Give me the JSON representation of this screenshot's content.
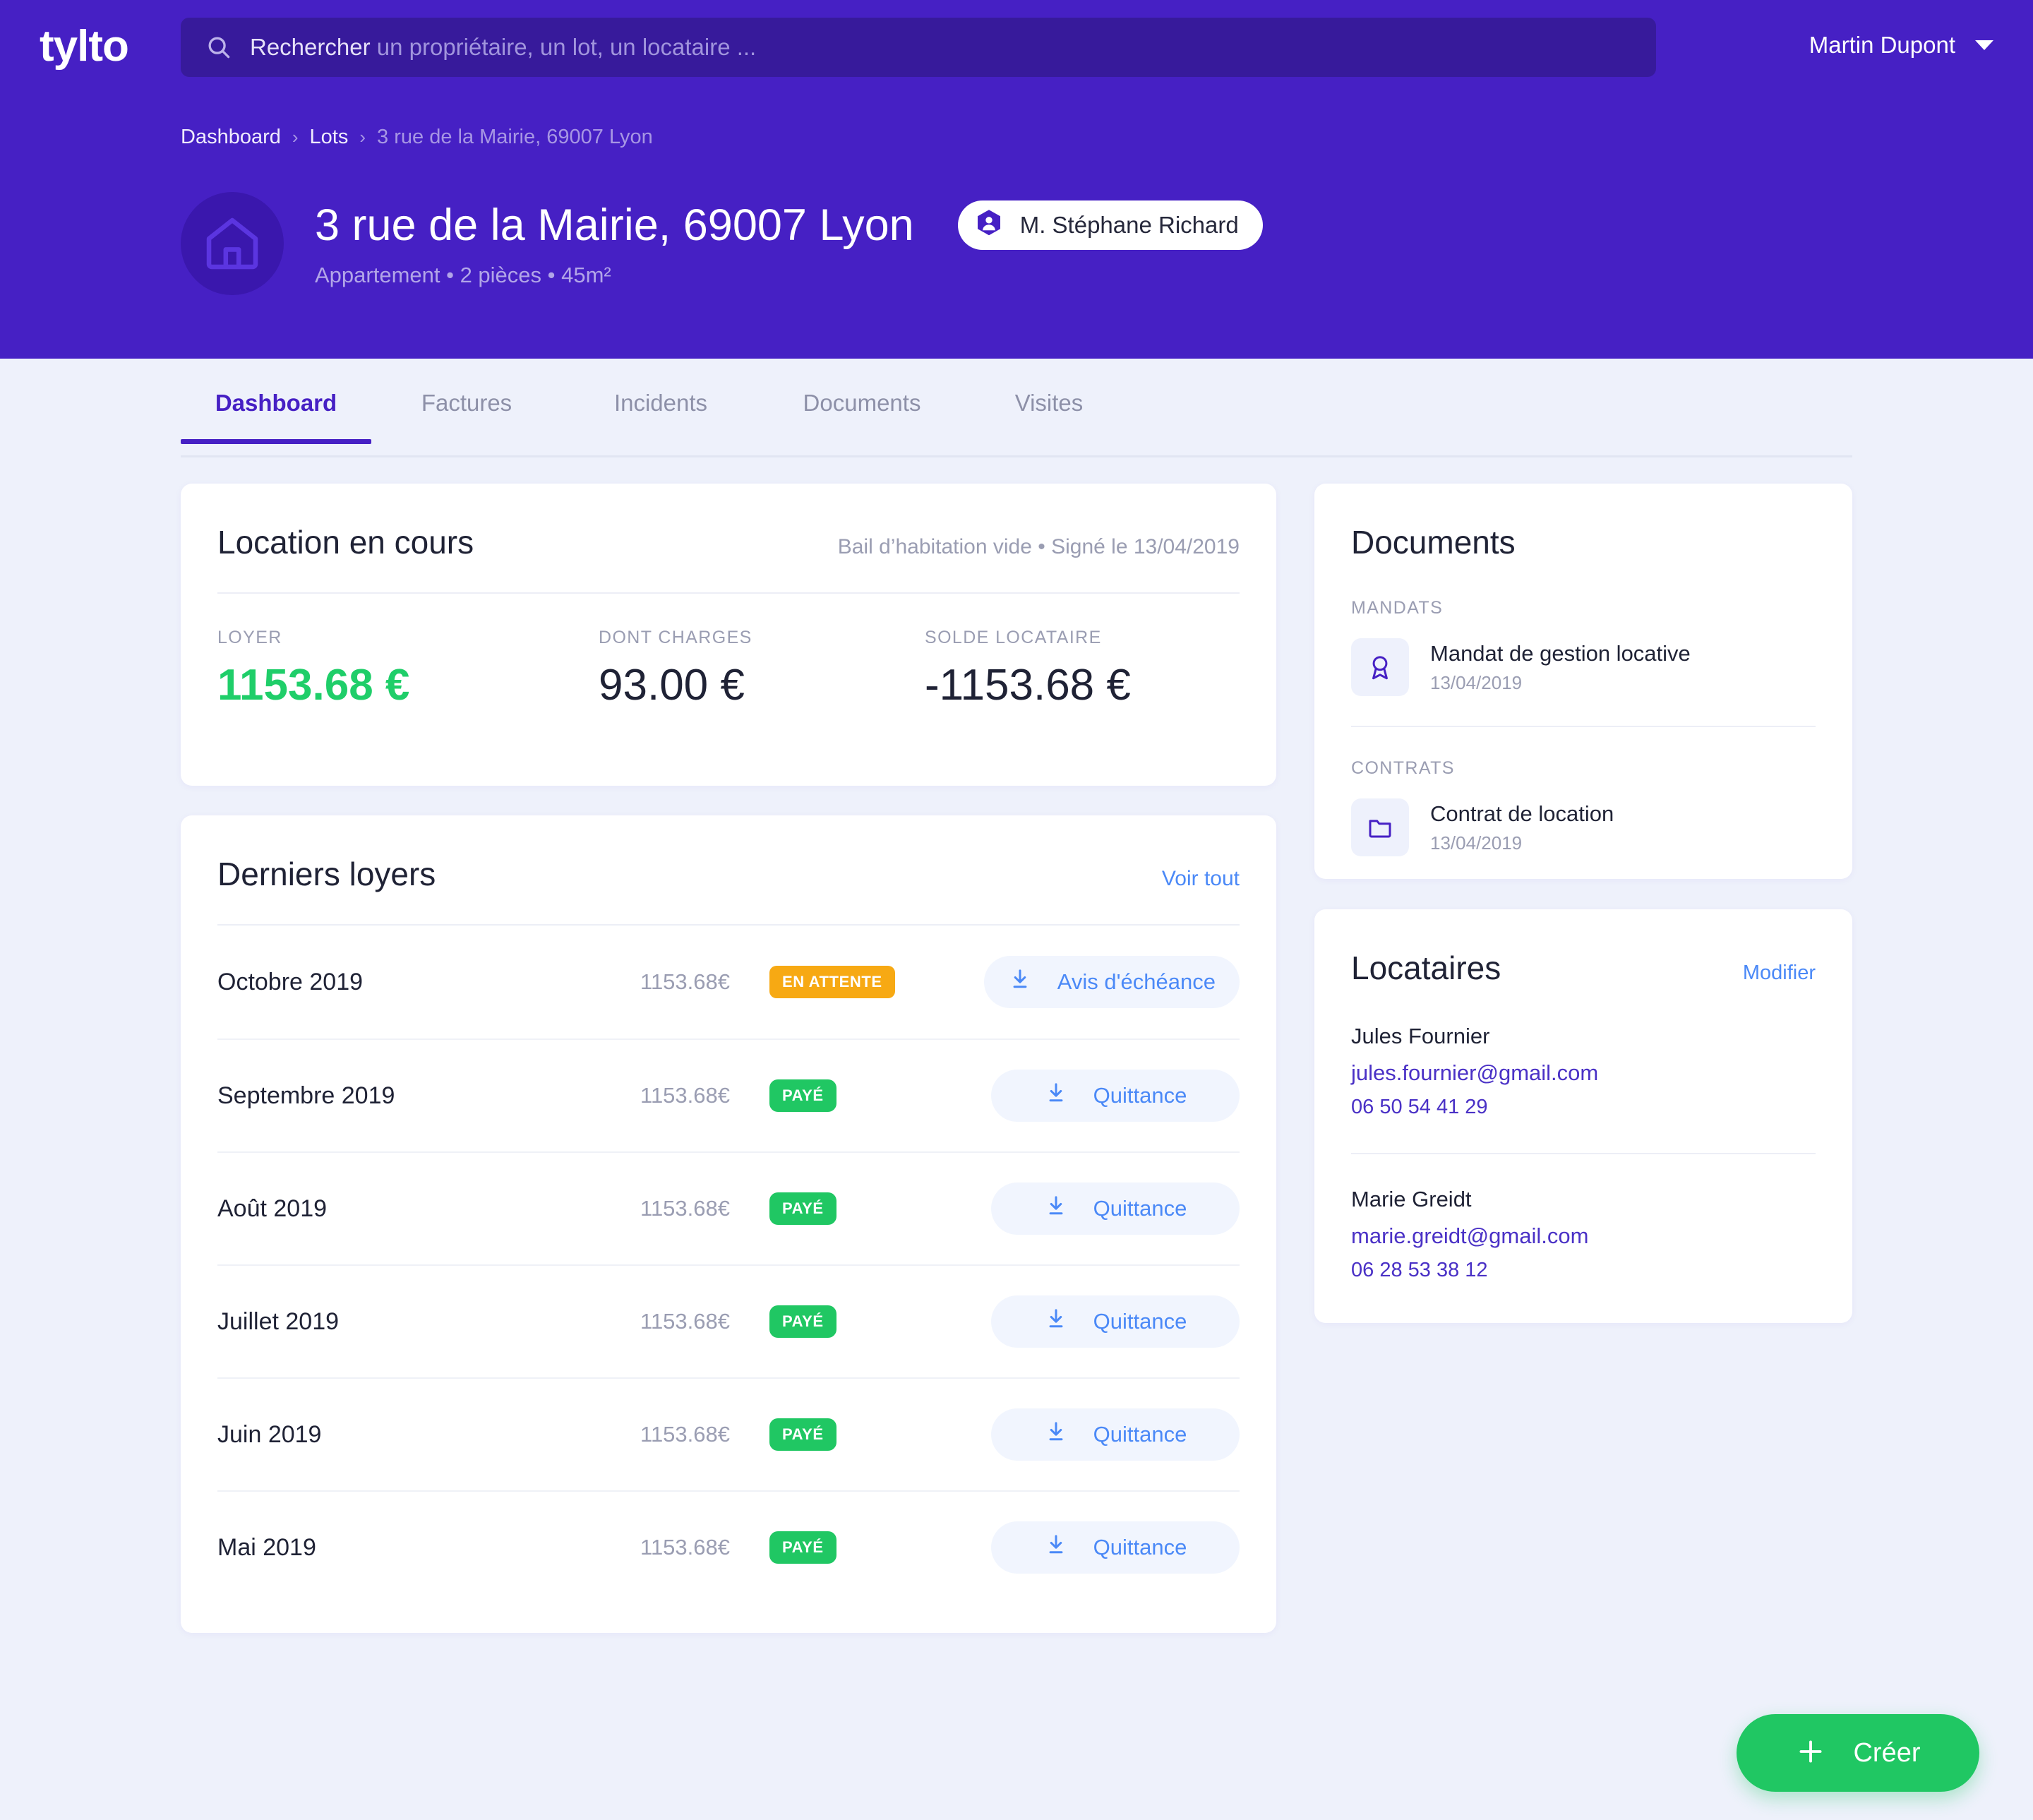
{
  "brand": {
    "logo": "tylto",
    "accent": "#4620c4",
    "green": "#20c763",
    "orange": "#f7a913",
    "link": "#4b89f7"
  },
  "topbar": {
    "search": {
      "prefix": "Rechercher",
      "placeholder": "un propriétaire, un lot, un locataire ..."
    },
    "user": {
      "name": "Martin Dupont"
    }
  },
  "breadcrumb": {
    "items": [
      "Dashboard",
      "Lots",
      "3 rue de la Mairie, 69007 Lyon"
    ],
    "separator": "›"
  },
  "property": {
    "title": "3 rue de la Mairie, 69007 Lyon",
    "meta": "Appartement  •  2 pièces  •  45m²",
    "owner": "M. Stéphane Richard"
  },
  "tabs": [
    {
      "label": "Dashboard",
      "active": true
    },
    {
      "label": "Factures",
      "active": false
    },
    {
      "label": "Incidents",
      "active": false
    },
    {
      "label": "Documents",
      "active": false
    },
    {
      "label": "Visites",
      "active": false
    }
  ],
  "location": {
    "title": "Location en cours",
    "subtitle": "Bail d’habitation vide  •  Signé le 13/04/2019",
    "metrics": [
      {
        "label": "LOYER",
        "value": "1153.68 €"
      },
      {
        "label": "DONT CHARGES",
        "value": "93.00 €"
      },
      {
        "label": "SOLDE LOCATAIRE",
        "value": "-1153.68 €"
      }
    ]
  },
  "loyers": {
    "title": "Derniers loyers",
    "see_all": "Voir tout",
    "rows": [
      {
        "month": "Octobre 2019",
        "amount": "1153.68€",
        "status": "EN ATTENTE",
        "status_type": "warn",
        "action": "Avis d'échéance"
      },
      {
        "month": "Septembre 2019",
        "amount": "1153.68€",
        "status": "PAYÉ",
        "status_type": "ok",
        "action": "Quittance"
      },
      {
        "month": "Août 2019",
        "amount": "1153.68€",
        "status": "PAYÉ",
        "status_type": "ok",
        "action": "Quittance"
      },
      {
        "month": "Juillet 2019",
        "amount": "1153.68€",
        "status": "PAYÉ",
        "status_type": "ok",
        "action": "Quittance"
      },
      {
        "month": "Juin 2019",
        "amount": "1153.68€",
        "status": "PAYÉ",
        "status_type": "ok",
        "action": "Quittance"
      },
      {
        "month": "Mai 2019",
        "amount": "1153.68€",
        "status": "PAYÉ",
        "status_type": "ok",
        "action": "Quittance"
      }
    ]
  },
  "documents": {
    "title": "Documents",
    "groups": [
      {
        "label": "MANDATS",
        "items": [
          {
            "name": "Mandat de gestion locative",
            "date": "13/04/2019",
            "icon": "award-icon"
          }
        ]
      },
      {
        "label": "CONTRATS",
        "items": [
          {
            "name": "Contrat de location",
            "date": "13/04/2019",
            "icon": "folder-icon"
          }
        ]
      }
    ]
  },
  "locataires": {
    "title": "Locataires",
    "edit": "Modifier",
    "tenants": [
      {
        "name": "Jules Fournier",
        "email": "jules.fournier@gmail.com",
        "phone": "06 50 54 41 29"
      },
      {
        "name": "Marie Greidt",
        "email": "marie.greidt@gmail.com",
        "phone": "06 28 53 38 12"
      }
    ]
  },
  "fab": {
    "label": "Créer",
    "icon": "plus-icon"
  }
}
